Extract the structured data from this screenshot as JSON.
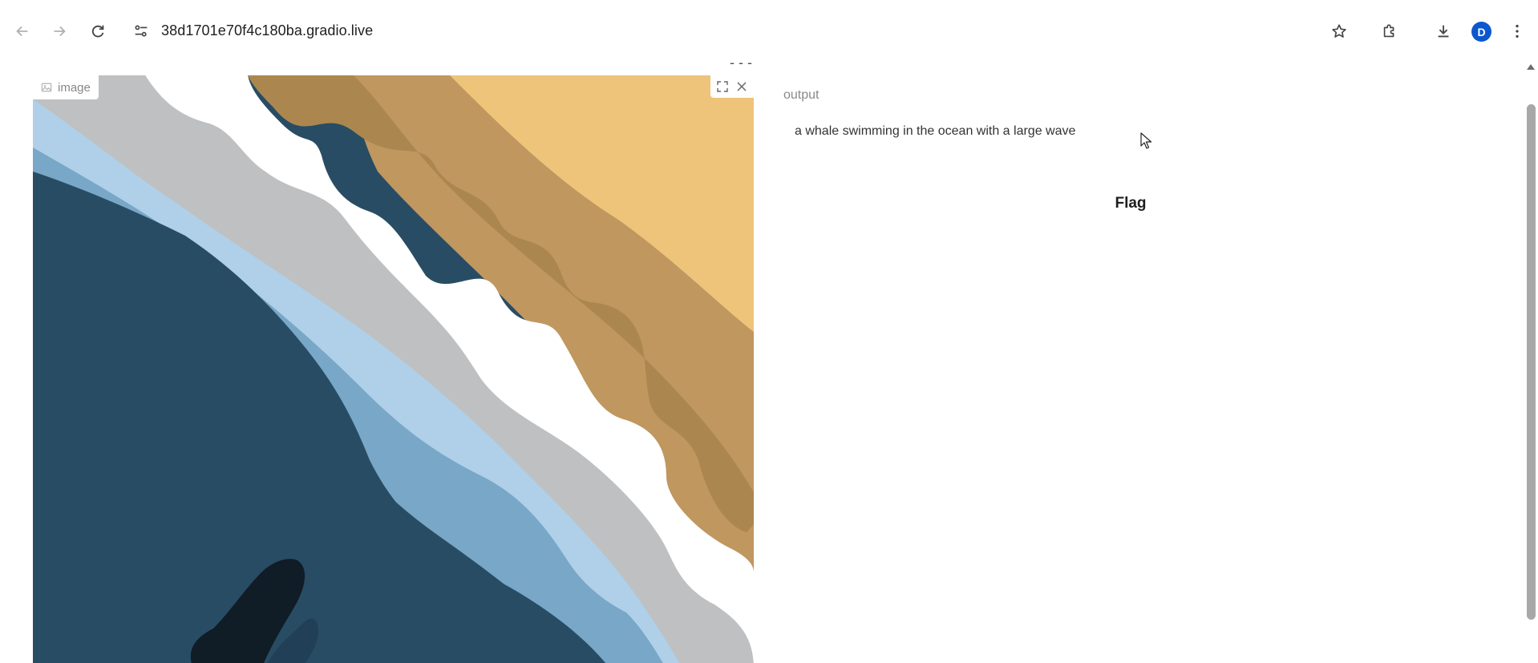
{
  "browser": {
    "url": "38d1701e70f4c180ba.gradio.live",
    "avatar_letter": "D"
  },
  "page": {
    "cut_off_text": "-  -  -",
    "image_component": {
      "label": "image"
    },
    "output_component": {
      "label": "output",
      "value": "a whale swimming in the ocean with a large wave"
    },
    "flag_button": {
      "label": "Flag"
    }
  },
  "colors": {
    "ocean_deep": "#284c64",
    "ocean_mid": "#78a7c7",
    "ocean_light": "#afd0e8",
    "foam_gray": "#bfc0c1",
    "sand_dark": "#ab874f",
    "sand_mid": "#bf975f",
    "sand_light": "#eec47a",
    "whale": "#101c26",
    "avatar": "#0b57d0"
  }
}
